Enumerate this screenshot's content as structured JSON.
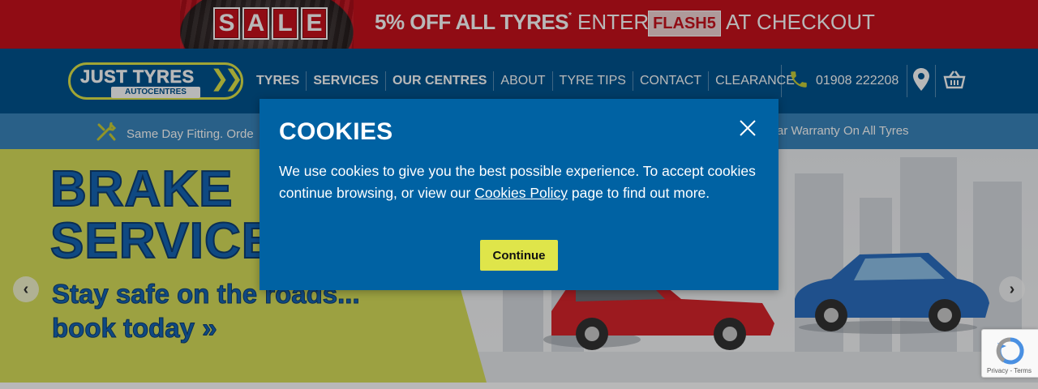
{
  "promo": {
    "sale_letters": [
      "S",
      "A",
      "L",
      "E"
    ],
    "offer": "5% OFF ALL TYRES",
    "offer_mark": "*",
    "enter": "ENTER",
    "code": "FLASH5",
    "checkout": "AT CHECKOUT"
  },
  "logo": {
    "main": "JUST TYRES",
    "sub": "AUTOCENTRES",
    "arrows": "❯❯"
  },
  "nav": {
    "items": [
      {
        "label": "TYRES"
      },
      {
        "label": "SERVICES"
      },
      {
        "label": "OUR CENTRES"
      },
      {
        "label": "ABOUT"
      },
      {
        "label": "TYRE TIPS"
      },
      {
        "label": "CONTACT"
      },
      {
        "label": "CLEARANCE"
      }
    ],
    "phone": "01908 222208"
  },
  "info": {
    "left": "Same Day Fitting. Orde",
    "right": "ar Warranty On All Tyres"
  },
  "hero": {
    "title_line1": "BRAKE",
    "title_line2": "SERVICE",
    "sub_line1": "Stay safe on the roads...",
    "sub_line2": "book today",
    "sub_arrows": "»",
    "prev": "‹",
    "next": "›"
  },
  "cookie": {
    "title": "COOKIES",
    "body_before": "We use cookies to give you the best possible experience. To accept cookies continue browsing, or view our ",
    "link": "Cookies Policy",
    "body_after": " page to find out more.",
    "button": "Continue"
  },
  "recaptcha": {
    "text": "Privacy - Terms"
  },
  "colors": {
    "promo_red": "#c8111d",
    "header_blue": "#00548f",
    "modal_blue": "#0062a3",
    "accent_yellow": "#dfe54a"
  }
}
